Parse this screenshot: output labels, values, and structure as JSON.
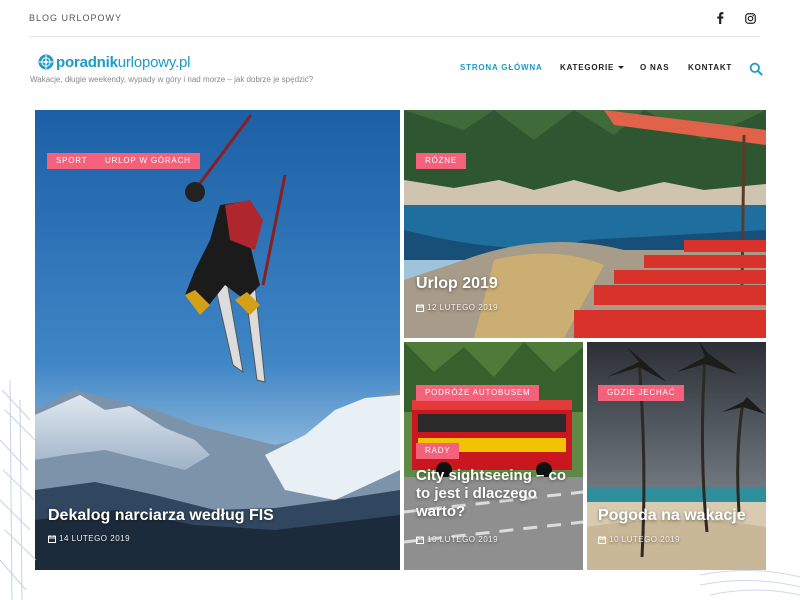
{
  "top_bar": {
    "blog_name": "BLOG URLOPOWY",
    "social_icons": [
      "facebook-icon",
      "instagram-icon"
    ]
  },
  "header": {
    "logo_text_main": "poradnik",
    "logo_text_rest": "urlopowy.pl",
    "tagline": "Wakacje, długie weekendy, wypady w góry i nad morze – jak dobrze je spędzić?",
    "nav": {
      "home": "STRONA GŁÓWNA",
      "categories": "KATEGORIE",
      "about": "O NAS",
      "contact": "KONTAKT"
    },
    "search_icon": "search-icon"
  },
  "colors": {
    "accent": "#1d9bc3",
    "tag": "#f5607a"
  },
  "posts": [
    {
      "tags": [
        "SPORT",
        "URLOP W GÓRACH"
      ],
      "title": "Dekalog narciarza według FIS",
      "date": "14 LUTEGO 2019"
    },
    {
      "tags": [
        "RÓŻNE"
      ],
      "title": "Urlop 2019",
      "date": "12 LUTEGO 2019"
    },
    {
      "tags": [
        "PODRÓŻE AUTOBUSEM",
        "RADY"
      ],
      "title": "City sightseeing – co to jest i dlaczego warto?",
      "date": "10 LUTEGO 2019"
    },
    {
      "tags": [
        "GDZIE JECHAĆ"
      ],
      "title": "Pogoda na wakacje",
      "date": "10 LUTEGO 2019"
    }
  ]
}
